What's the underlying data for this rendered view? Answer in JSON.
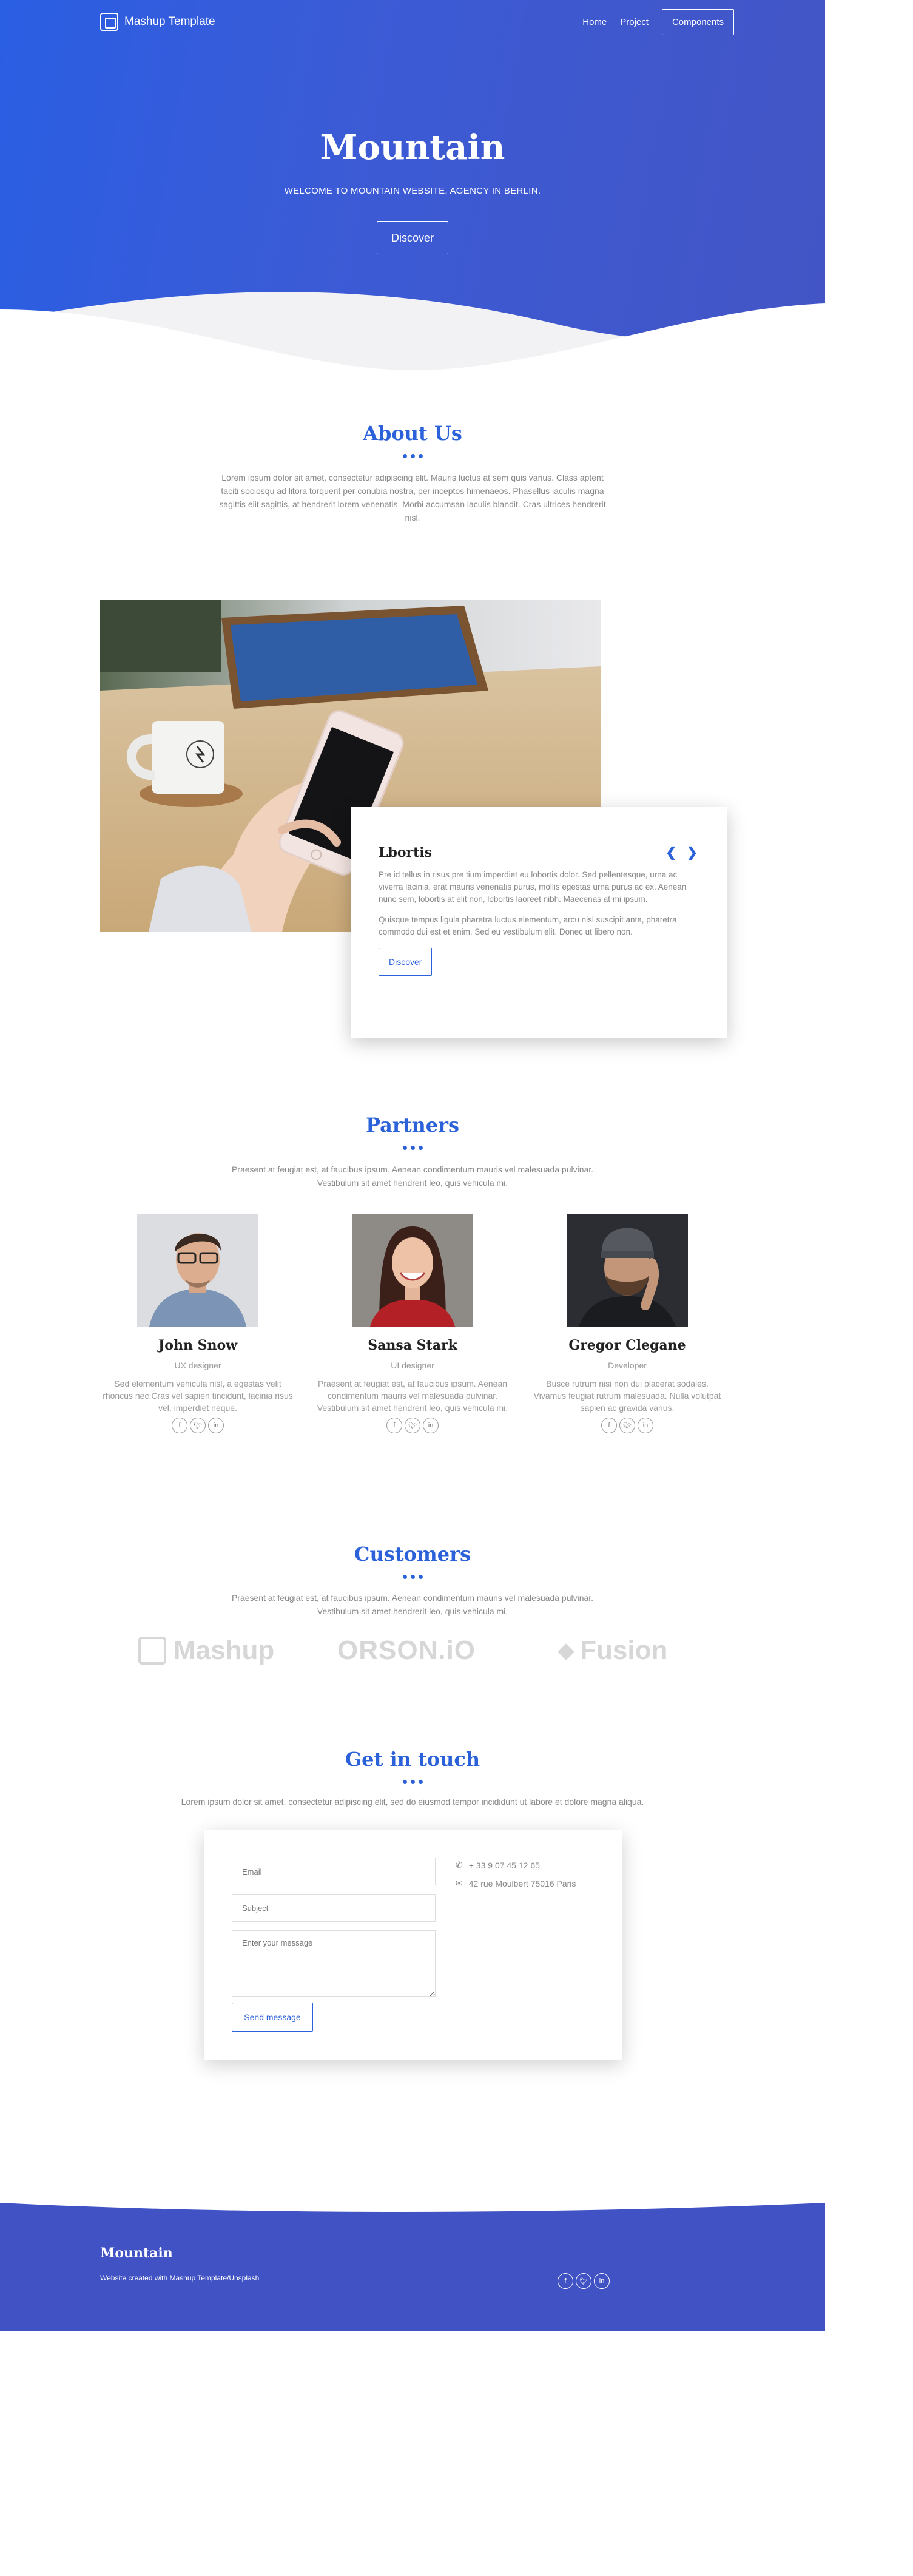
{
  "nav": {
    "brand": "Mashup Template",
    "links": [
      "Home",
      "Project"
    ],
    "cta": "Components"
  },
  "hero": {
    "title": "Mountain",
    "subtitle": "WELCOME TO MOUNTAIN WEBSITE, AGENCY IN BERLIN.",
    "button": "Discover"
  },
  "about": {
    "title": "About Us",
    "text": "Lorem ipsum dolor sit amet, consectetur adipiscing elit. Mauris luctus at sem quis varius. Class aptent taciti sociosqu ad litora torquent per conubia nostra, per inceptos himenaeos. Phasellus iaculis magna sagittis elit sagittis, at hendrerit lorem venenatis. Morbi accumsan iaculis blandit. Cras ultrices hendrerit nisl.",
    "card": {
      "title": "Lbortis",
      "p1": "Pre id tellus in risus pre tium imperdiet eu lobortis dolor. Sed pellentesque, urna ac viverra lacinia, erat mauris venenatis purus, mollis egestas urna purus ac ex. Aenean nunc sem, lobortis at elit non, lobortis laoreet nibh. Maecenas at mi ipsum.",
      "p2": "Quisque tempus ligula pharetra luctus elementum, arcu nisl suscipit ante, pharetra commodo dui est et enim. Sed eu vestibulum elit. Donec ut libero non.",
      "button": "Discover"
    }
  },
  "partners": {
    "title": "Partners",
    "text": "Praesent at feugiat est, at faucibus ipsum. Aenean condimentum mauris vel malesuada pulvinar. Vestibulum sit amet hendrerit leo, quis vehicula mi.",
    "members": [
      {
        "name": "John Snow",
        "role": "UX designer",
        "desc": "Sed elementum vehicula nisl, a egestas velit rhoncus nec.Cras vel sapien tincidunt, lacinia risus vel, imperdiet neque."
      },
      {
        "name": "Sansa Stark",
        "role": "UI designer",
        "desc": "Praesent at feugiat est, at faucibus ipsum. Aenean condimentum mauris vel malesuada pulvinar. Vestibulum sit amet hendrerit leo, quis vehicula mi."
      },
      {
        "name": "Gregor Clegane",
        "role": "Developer",
        "desc": "Busce rutrum nisi non dui placerat sodales. Vivamus feugiat rutrum malesuada. Nulla volutpat sapien ac gravida varius."
      }
    ]
  },
  "customers": {
    "title": "Customers",
    "text": "Praesent at feugiat est, at faucibus ipsum. Aenean condimentum mauris vel malesuada pulvinar. Vestibulum sit amet hendrerit leo, quis vehicula mi.",
    "logos": [
      "Mashup",
      "ORSON.iO",
      "Fusion"
    ]
  },
  "contact": {
    "title": "Get in touch",
    "text": "Lorem ipsum dolor sit amet, consectetur adipiscing elit, sed do eiusmod tempor incididunt ut labore et dolore magna aliqua.",
    "email_placeholder": "Email",
    "subject_placeholder": "Subject",
    "message_placeholder": "Enter your message",
    "button": "Send message",
    "phone": "+ 33 9 07 45 12 65",
    "address": "42 rue Moulbert 75016 Paris"
  },
  "footer": {
    "title": "Mountain",
    "text": "Website created with Mashup Template/Unsplash"
  },
  "colors": {
    "accent": "#2b62d9",
    "hero_start": "#2a5ee3",
    "hero_end": "#4355c5",
    "footer": "#4152c4"
  }
}
